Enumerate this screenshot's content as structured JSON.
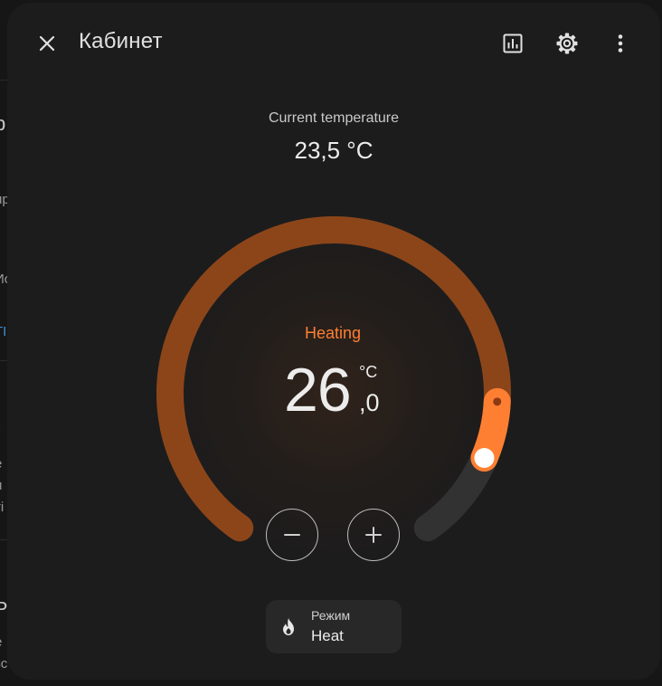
{
  "dialog": {
    "title": "Кабинет"
  },
  "toolbar": {
    "close_icon": "close-icon",
    "history_icon": "history-chart-icon",
    "settings_icon": "gear-icon",
    "more_icon": "more-vertical-icon"
  },
  "current": {
    "label": "Current temperature",
    "value": "23,5 °C"
  },
  "target": {
    "action": "Heating",
    "integer": "26",
    "decimal": ",0",
    "unit": "°C",
    "level": 0.89,
    "current_level": 0.82
  },
  "controls": {
    "decrease_icon": "minus-icon",
    "increase_icon": "plus-icon"
  },
  "mode": {
    "label": "Режим",
    "value": "Heat",
    "icon": "fire-icon"
  },
  "background_fragments": {
    "items": [
      "р",
      "ир",
      "Ис",
      "ТІ",
      "\\",
      "е",
      "и",
      "ті",
      "Ь",
      "е",
      "зс"
    ]
  },
  "colors": {
    "accent": "#ff7f32",
    "arc_track": "#8c4519",
    "arc_inactive": "#323232",
    "surface": "#1c1c1c"
  }
}
